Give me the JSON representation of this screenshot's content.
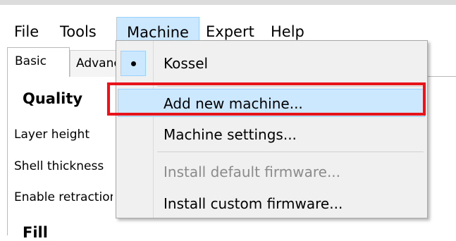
{
  "menubar": {
    "items": [
      "File",
      "Tools",
      "Machine",
      "Expert",
      "Help"
    ]
  },
  "tabs": {
    "basic": "Basic",
    "advanced": "Advanced"
  },
  "panel": {
    "quality_heading": "Quality",
    "layer_height": "Layer height",
    "shell_thickness": "Shell thickness",
    "enable_retraction": "Enable retraction",
    "fill_heading": "Fill"
  },
  "machine_menu": {
    "items": [
      {
        "label": "Kossel",
        "checked": true
      },
      {
        "label": "Add new machine...",
        "highlighted": true
      },
      {
        "label": "Machine settings..."
      },
      {
        "label": "Install default firmware...",
        "disabled": true
      },
      {
        "label": "Install custom firmware..."
      }
    ]
  },
  "colors": {
    "highlight_fill": "#cce8ff",
    "highlight_border": "#99d1ff",
    "annotation_red": "#e8141c",
    "disabled_text": "#8b8b8b"
  }
}
